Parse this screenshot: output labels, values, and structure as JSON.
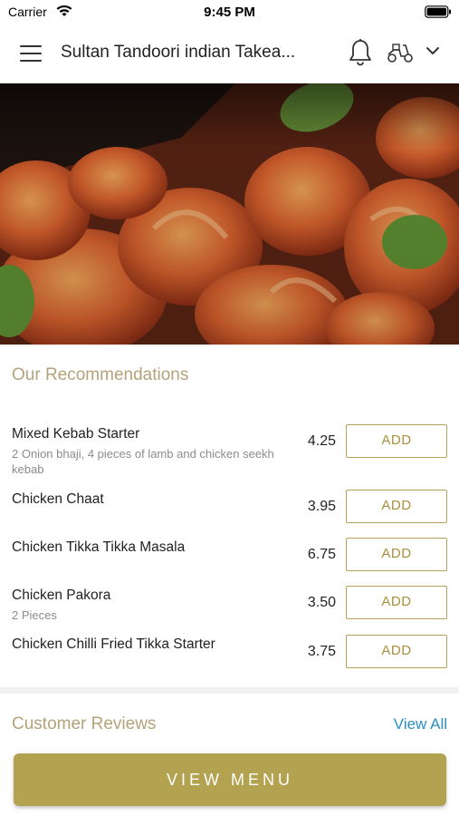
{
  "status_bar": {
    "carrier": "Carrier",
    "time": "9:45 PM"
  },
  "header": {
    "title": "Sultan Tandoori indian Takea...",
    "icons": [
      "menu-icon",
      "bell-icon",
      "scooter-icon",
      "chevron-down-icon"
    ]
  },
  "hero": {
    "image": "dish-photo-tandoori-prawns"
  },
  "recommendations": {
    "title": "Our Recommendations",
    "items": [
      {
        "name": "Mixed Kebab Starter",
        "description": "2 Onion bhaji, 4 pieces of lamb and chicken seekh kebab",
        "price": "4.25",
        "button": "ADD"
      },
      {
        "name": "Chicken Chaat",
        "description": "",
        "price": "3.95",
        "button": "ADD"
      },
      {
        "name": "Chicken Tikka Tikka Masala",
        "description": "",
        "price": "6.75",
        "button": "ADD"
      },
      {
        "name": "Chicken Pakora",
        "description": "2 Pieces",
        "price": "3.50",
        "button": "ADD"
      },
      {
        "name": "Chicken Chilli Fried Tikka Starter",
        "description": "",
        "price": "3.75",
        "button": "ADD"
      }
    ]
  },
  "reviews": {
    "title": "Customer Reviews",
    "view_all": "View All"
  },
  "footer": {
    "view_menu": "VIEW MENU"
  },
  "colors": {
    "accent_gold": "#b3a24f",
    "heading_gold": "#b4a37a",
    "link_blue": "#2a8ec0"
  }
}
